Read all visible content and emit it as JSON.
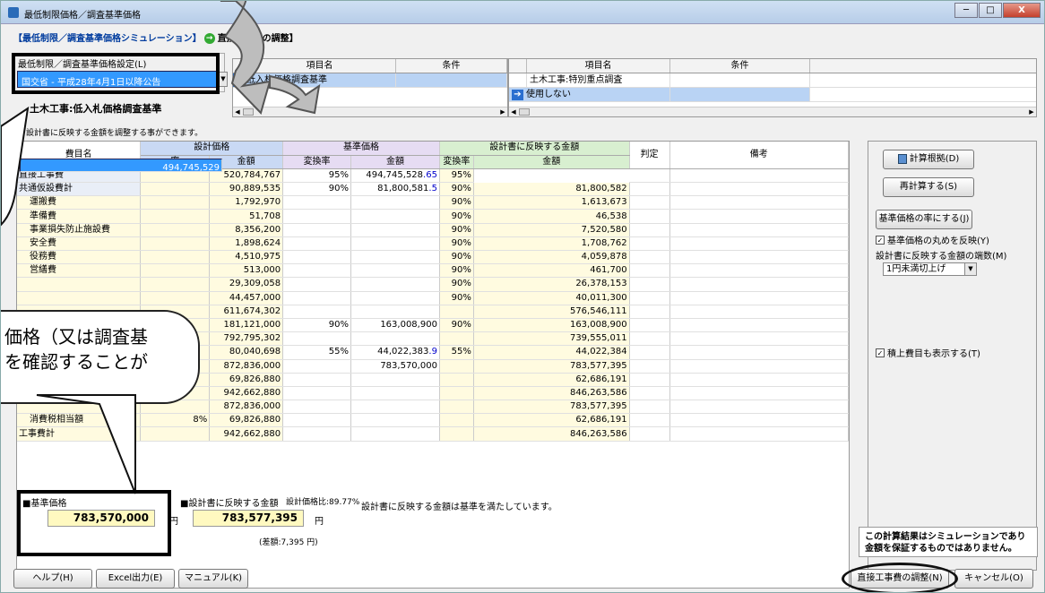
{
  "window": {
    "title": "最低制限価格／調査基準価格",
    "minimize": "─",
    "maximize": "□",
    "close": "X"
  },
  "subtitle": {
    "main": "【最低制限／調査基準価格シミュレーション】",
    "step_icon": "→",
    "step": "直接工事費の調整】"
  },
  "settings": {
    "label": "最低制限／調査基準価格設定(L)",
    "selected": "国交省 - 平成28年4月1日以降公告",
    "arrow": "▼"
  },
  "cond_table_left": {
    "headers": [
      "項目名",
      "条件"
    ],
    "rows": [
      [
        "低入札価格調査基準",
        ""
      ]
    ]
  },
  "cond_table_right": {
    "headers": [
      "項目名",
      "条件"
    ],
    "rows": [
      [
        "土木工事:特別重点調査",
        ""
      ],
      [
        "使用しない",
        ""
      ]
    ],
    "arrow_icon": "➔"
  },
  "scroll": {
    "left": "◀",
    "right": "▶"
  },
  "heading": "土木工事:低入札価格調査基準",
  "note": "設計書に反映する金額を調整する事ができます。",
  "grid": {
    "group_headers": {
      "name": "費目名",
      "design": "設計価格",
      "standard": "基準価格",
      "reflect": "設計書に反映する金額",
      "judge": "判定",
      "remarks": "備考"
    },
    "sub_headers": {
      "rate": "率",
      "amount": "金額",
      "conv_rate": "変換率",
      "std_amount": "金額",
      "ref_rate": "変換率",
      "ref_amount": "金額"
    },
    "rows": [
      {
        "name": "直接工事費",
        "rate": "",
        "amount": "520,784,767",
        "conv": "95%",
        "std": "494,745,528",
        "dec": ".65",
        "rconv": "95%",
        "ref": "494,745,529"
      },
      {
        "name": "共通仮設費計",
        "rate": "",
        "amount": "90,889,535",
        "conv": "90%",
        "std": "81,800,581",
        "dec": ".5",
        "rconv": "90%",
        "ref": "81,800,582"
      },
      {
        "name": "運搬費",
        "rate": "",
        "amount": "1,792,970",
        "conv": "",
        "std": "",
        "dec": "",
        "rconv": "90%",
        "ref": "1,613,673"
      },
      {
        "name": "準備費",
        "rate": "",
        "amount": "51,708",
        "conv": "",
        "std": "",
        "dec": "",
        "rconv": "90%",
        "ref": "46,538"
      },
      {
        "name": "事業損失防止施設費",
        "rate": "",
        "amount": "8,356,200",
        "conv": "",
        "std": "",
        "dec": "",
        "rconv": "90%",
        "ref": "7,520,580"
      },
      {
        "name": "安全費",
        "rate": "",
        "amount": "1,898,624",
        "conv": "",
        "std": "",
        "dec": "",
        "rconv": "90%",
        "ref": "1,708,762"
      },
      {
        "name": "役務費",
        "rate": "",
        "amount": "4,510,975",
        "conv": "",
        "std": "",
        "dec": "",
        "rconv": "90%",
        "ref": "4,059,878"
      },
      {
        "name": "営繕費",
        "rate": "",
        "amount": "513,000",
        "conv": "",
        "std": "",
        "dec": "",
        "rconv": "90%",
        "ref": "461,700"
      },
      {
        "name": "",
        "rate": "",
        "amount": "29,309,058",
        "conv": "",
        "std": "",
        "dec": "",
        "rconv": "90%",
        "ref": "26,378,153"
      },
      {
        "name": "",
        "rate": "",
        "amount": "44,457,000",
        "conv": "",
        "std": "",
        "dec": "",
        "rconv": "90%",
        "ref": "40,011,300"
      },
      {
        "name": "",
        "rate": "",
        "amount": "611,674,302",
        "conv": "",
        "std": "",
        "dec": "",
        "rconv": "",
        "ref": "576,546,111"
      },
      {
        "name": "",
        "rate": "",
        "amount": "181,121,000",
        "conv": "90%",
        "std": "163,008,900",
        "dec": "",
        "rconv": "90%",
        "ref": "163,008,900"
      },
      {
        "name": "",
        "rate": "",
        "amount": "792,795,302",
        "conv": "",
        "std": "",
        "dec": "",
        "rconv": "",
        "ref": "739,555,011"
      },
      {
        "name": "",
        "rate": "",
        "amount": "80,040,698",
        "conv": "55%",
        "std": "44,022,383",
        "dec": ".9",
        "rconv": "55%",
        "ref": "44,022,384"
      },
      {
        "name": "",
        "rate": "",
        "amount": "872,836,000",
        "conv": "",
        "std": "783,570,000",
        "dec": "",
        "rconv": "",
        "ref": "783,577,395"
      },
      {
        "name": "",
        "rate": "",
        "amount": "69,826,880",
        "conv": "",
        "std": "",
        "dec": "",
        "rconv": "",
        "ref": "62,686,191"
      },
      {
        "name": "",
        "rate": "",
        "amount": "942,662,880",
        "conv": "",
        "std": "",
        "dec": "",
        "rconv": "",
        "ref": "846,263,586"
      },
      {
        "name": "",
        "rate": "",
        "amount": "872,836,000",
        "conv": "",
        "std": "",
        "dec": "",
        "rconv": "",
        "ref": "783,577,395"
      },
      {
        "name": "消費税相当額",
        "rate": "8%",
        "amount": "69,826,880",
        "conv": "",
        "std": "",
        "dec": "",
        "rconv": "",
        "ref": "62,686,191"
      },
      {
        "name": "工事費計",
        "rate": "",
        "amount": "942,662,880",
        "conv": "",
        "std": "",
        "dec": "",
        "rconv": "",
        "ref": "846,263,586"
      }
    ]
  },
  "right_panel": {
    "calc_basis": "計算根拠(D)",
    "recalc": "再計算する(S)",
    "to_std_rate": "基準価格の率にする(J)",
    "reflect_rounding": "基準価格の丸めを反映(Y)",
    "fraction_label": "設計書に反映する金額の端数(M)",
    "fraction_value": "1円未満切上げ",
    "fraction_arrow": "▼",
    "show_estimate": "積上費目も表示する(T)",
    "check_mark": "✓"
  },
  "summary": {
    "std_label": "■基準価格",
    "std_value": "783,570,000",
    "yen1": "円",
    "ref_label": "■設計書に反映する金額",
    "ratio": "設計価格比:89.77%",
    "status": "設計書に反映する金額は基準を満たしています。",
    "ref_value": "783,577,395",
    "yen2": "円",
    "diff": "(差額:7,395 円)"
  },
  "warning": {
    "line1": "この計算結果はシミュレーションであり",
    "line2": "金額を保証するものではありません。"
  },
  "footer": {
    "help": "ヘルプ(H)",
    "excel": "Excel出力(E)",
    "manual": "マニュアル(K)",
    "adjust": "直接工事費の調整(N)",
    "cancel": "キャンセル(O)"
  },
  "callout": {
    "line1": "価格（又は調査基",
    "line2": "を確認することが"
  }
}
